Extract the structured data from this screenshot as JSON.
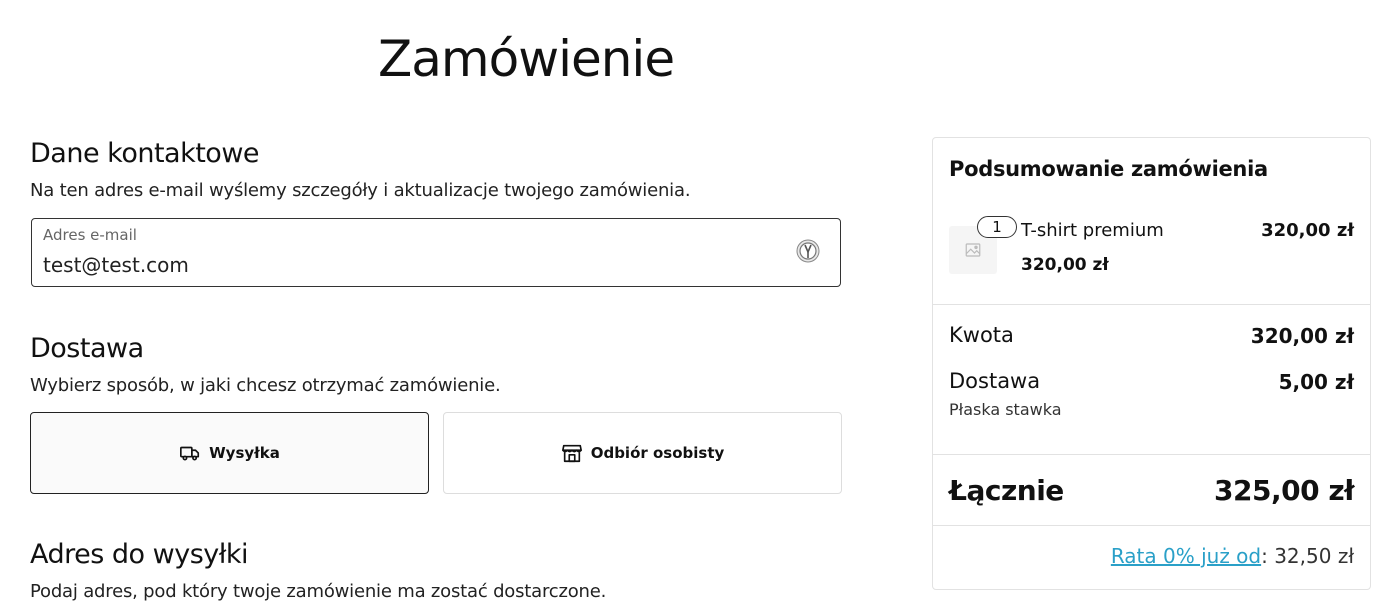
{
  "page": {
    "title": "Zamówienie"
  },
  "contact": {
    "title": "Dane kontaktowe",
    "description": "Na ten adres e-mail wyślemy szczegóły i aktualizacje twojego zamówienia.",
    "email_label": "Adres e-mail",
    "email_value": "test@test.com"
  },
  "delivery": {
    "title": "Dostawa",
    "description": "Wybierz sposób, w jaki chcesz otrzymać zamówienie.",
    "options": [
      {
        "label": "Wysyłka",
        "icon": "truck-icon",
        "selected": true
      },
      {
        "label": "Odbiór osobisty",
        "icon": "store-icon",
        "selected": false
      }
    ]
  },
  "shipping_address": {
    "title": "Adres do wysyłki",
    "description": "Podaj adres, pod który twoje zamówienie ma zostać dostarczone."
  },
  "summary": {
    "title": "Podsumowanie zamówienia",
    "item": {
      "quantity": "1",
      "name": "T-shirt premium",
      "unit_price": "320,00 zł",
      "line_total": "320,00 zł"
    },
    "subtotal_label": "Kwota",
    "subtotal_value": "320,00 zł",
    "shipping_label": "Dostawa",
    "shipping_value": "5,00 zł",
    "shipping_method": "Płaska stawka",
    "total_label": "Łącznie",
    "total_value": "325,00 zł",
    "installment_link": "Rata 0% już od",
    "installment_value": ": 32,50 zł"
  },
  "colors": {
    "link": "#2aa0c8",
    "border_selected": "#222222",
    "border_light": "#dddddd"
  }
}
